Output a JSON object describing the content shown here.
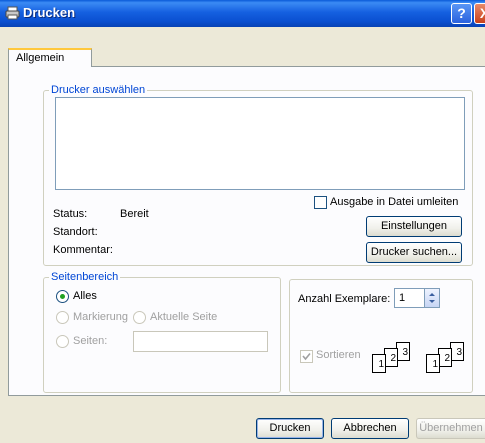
{
  "window": {
    "title": "Drucken",
    "help_label": "?",
    "close_label": "X"
  },
  "tabs": [
    {
      "label": "Allgemein"
    }
  ],
  "printer_group": {
    "legend": "Drucker auswählen",
    "status_label": "Status:",
    "status_value": "Bereit",
    "location_label": "Standort:",
    "comment_label": "Kommentar:",
    "print_to_file_label": "Ausgabe in Datei umleiten",
    "print_to_file_checked": false,
    "settings_button": "Einstellungen",
    "find_printer_button": "Drucker suchen..."
  },
  "page_range": {
    "legend": "Seitenbereich",
    "all_label": "Alles",
    "selection_label": "Markierung",
    "current_page_label": "Aktuelle Seite",
    "pages_label": "Seiten:",
    "pages_value": "",
    "selected": "all"
  },
  "copies": {
    "label": "Anzahl Exemplare:",
    "value": "1",
    "collate_label": "Sortieren",
    "collate_checked": true,
    "collate_enabled": false,
    "page_icon_numbers": [
      "1",
      "2",
      "3"
    ]
  },
  "footer": {
    "print_button": "Drucken",
    "cancel_button": "Abbrechen",
    "apply_button": "Übernehmen"
  },
  "colors": {
    "titlebar": "#0a4fd0",
    "dialog_bg": "#ECE9D8",
    "group_legend": "#0046d5",
    "radio_dot": "#21a121"
  }
}
